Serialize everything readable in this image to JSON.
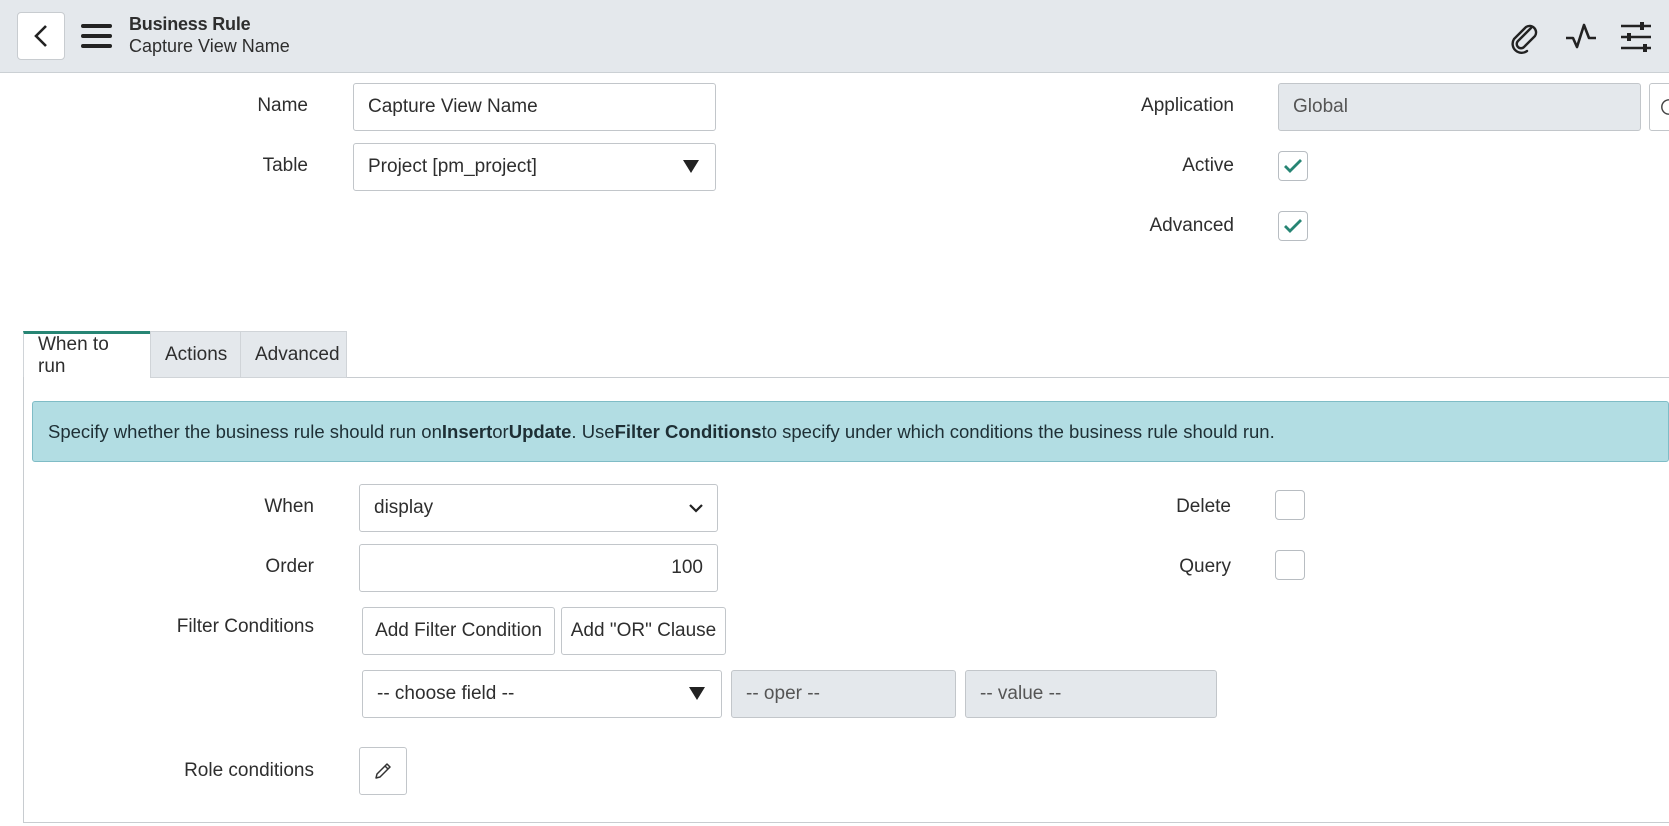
{
  "header": {
    "title": "Business Rule",
    "subtitle": "Capture View Name",
    "icons": [
      "back-icon",
      "menu-icon",
      "paperclip-icon",
      "activity-icon",
      "settings-sliders-icon"
    ]
  },
  "form": {
    "name_label": "Name",
    "name_value": "Capture View Name",
    "table_label": "Table",
    "table_value": "Project [pm_project]",
    "application_label": "Application",
    "application_value": "Global",
    "active_label": "Active",
    "active_checked": true,
    "advanced_label": "Advanced",
    "advanced_checked": true
  },
  "tabs": [
    {
      "label": "When to run",
      "active": true
    },
    {
      "label": "Actions",
      "active": false
    },
    {
      "label": "Advanced",
      "active": false
    }
  ],
  "when_to_run": {
    "info": {
      "p1": "Specify whether the business rule should run on ",
      "b1": "Insert",
      "p2": " or ",
      "b2": "Update",
      "p3": ". Use ",
      "b3": "Filter Conditions",
      "p4": " to specify under which conditions the business rule should run."
    },
    "when_label": "When",
    "when_value": "display",
    "order_label": "Order",
    "order_value": "100",
    "delete_label": "Delete",
    "delete_checked": false,
    "query_label": "Query",
    "query_checked": false,
    "filter_label": "Filter Conditions",
    "add_filter_label": "Add Filter Condition",
    "add_or_label": "Add \"OR\" Clause",
    "choose_field": "-- choose field --",
    "oper": "-- oper --",
    "value": "-- value --",
    "role_label": "Role conditions"
  },
  "colors": {
    "header_bg": "#e4e8ec",
    "accent": "#278574",
    "info_bg": "#b2dde3"
  }
}
